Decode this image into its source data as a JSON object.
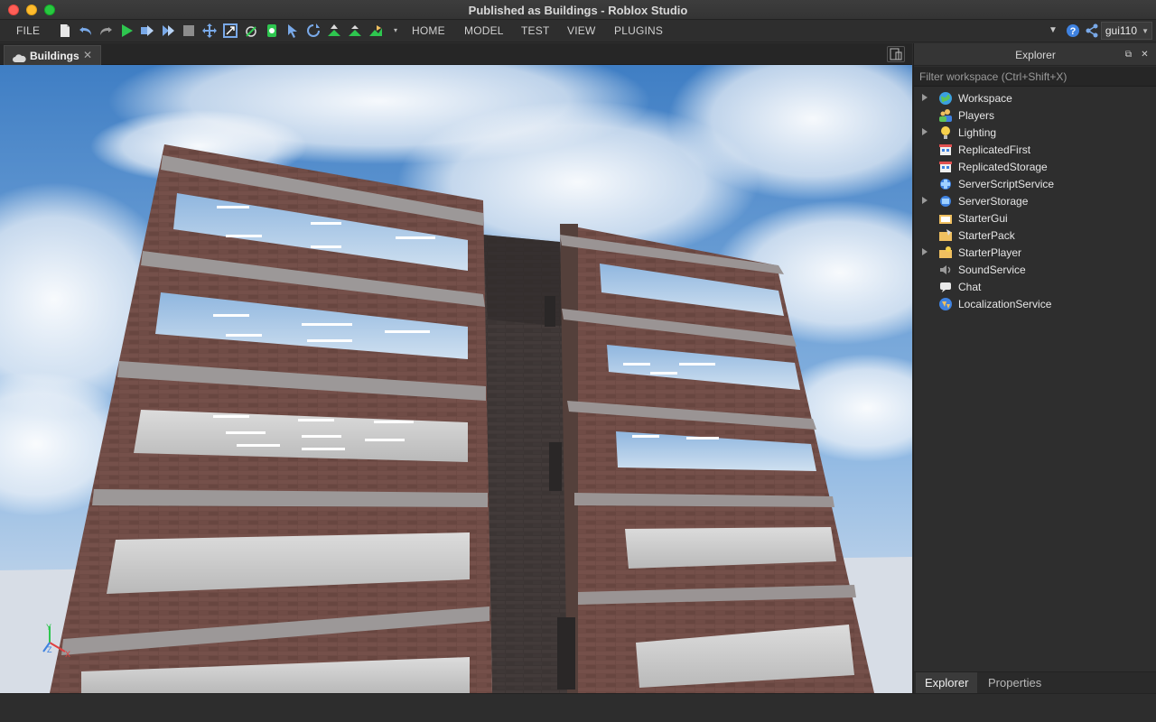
{
  "window": {
    "title": "Published as Buildings - Roblox Studio"
  },
  "menu": {
    "file": "FILE",
    "tabs": [
      "HOME",
      "MODEL",
      "TEST",
      "VIEW",
      "PLUGINS"
    ],
    "user": "gui110"
  },
  "document_tab": {
    "label": "Buildings",
    "close": "✕"
  },
  "explorer": {
    "title": "Explorer",
    "filter_placeholder": "Filter workspace (Ctrl+Shift+X)",
    "items": [
      {
        "label": "Workspace",
        "expandable": true,
        "icon": "globe-icon"
      },
      {
        "label": "Players",
        "expandable": false,
        "icon": "players-icon"
      },
      {
        "label": "Lighting",
        "expandable": true,
        "icon": "lightbulb-icon"
      },
      {
        "label": "ReplicatedFirst",
        "expandable": false,
        "icon": "replicated-first-icon"
      },
      {
        "label": "ReplicatedStorage",
        "expandable": false,
        "icon": "replicated-storage-icon"
      },
      {
        "label": "ServerScriptService",
        "expandable": false,
        "icon": "server-script-service-icon"
      },
      {
        "label": "ServerStorage",
        "expandable": true,
        "icon": "server-storage-icon"
      },
      {
        "label": "StarterGui",
        "expandable": false,
        "icon": "starter-gui-icon"
      },
      {
        "label": "StarterPack",
        "expandable": false,
        "icon": "starter-pack-icon"
      },
      {
        "label": "StarterPlayer",
        "expandable": true,
        "icon": "starter-player-icon"
      },
      {
        "label": "SoundService",
        "expandable": false,
        "icon": "sound-icon"
      },
      {
        "label": "Chat",
        "expandable": false,
        "icon": "chat-icon"
      },
      {
        "label": "LocalizationService",
        "expandable": false,
        "icon": "localization-icon"
      }
    ],
    "tabs": [
      "Explorer",
      "Properties"
    ],
    "active_tab": "Explorer"
  },
  "colors": {
    "accent_blue": "#79a9e8",
    "play_green": "#2ec64f",
    "brick": "#6b4a44",
    "sky": "#6fa2d6"
  }
}
